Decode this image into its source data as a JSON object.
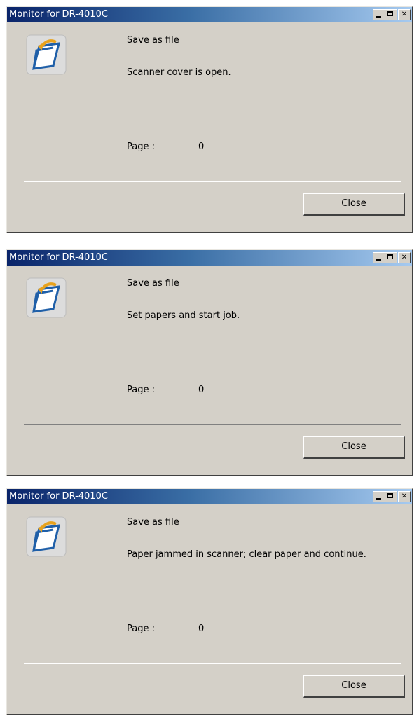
{
  "windows": [
    {
      "title": "Monitor for DR-4010C",
      "job_label": "Save as file",
      "message": "Scanner cover is open.",
      "page_label": "Page :",
      "page_value": "0",
      "close_button": {
        "mnemonic": "C",
        "rest": "lose"
      }
    },
    {
      "title": "Monitor for DR-4010C",
      "job_label": "Save as file",
      "message": "Set papers and start job.",
      "page_label": "Page :",
      "page_value": "0",
      "close_button": {
        "mnemonic": "C",
        "rest": "lose"
      }
    },
    {
      "title": "Monitor for DR-4010C",
      "job_label": "Save as file",
      "message": "Paper jammed in scanner; clear paper and continue.",
      "page_label": "Page :",
      "page_value": "0",
      "close_button": {
        "mnemonic": "C",
        "rest": "lose"
      }
    }
  ],
  "icons": {
    "app": "open-folder-icon",
    "minimize": "minimize-icon",
    "maximize": "maximize-icon",
    "close": "close-icon"
  },
  "colors": {
    "face": "#d4d0c8",
    "title_start": "#0a246a",
    "title_end": "#a6caf0"
  }
}
